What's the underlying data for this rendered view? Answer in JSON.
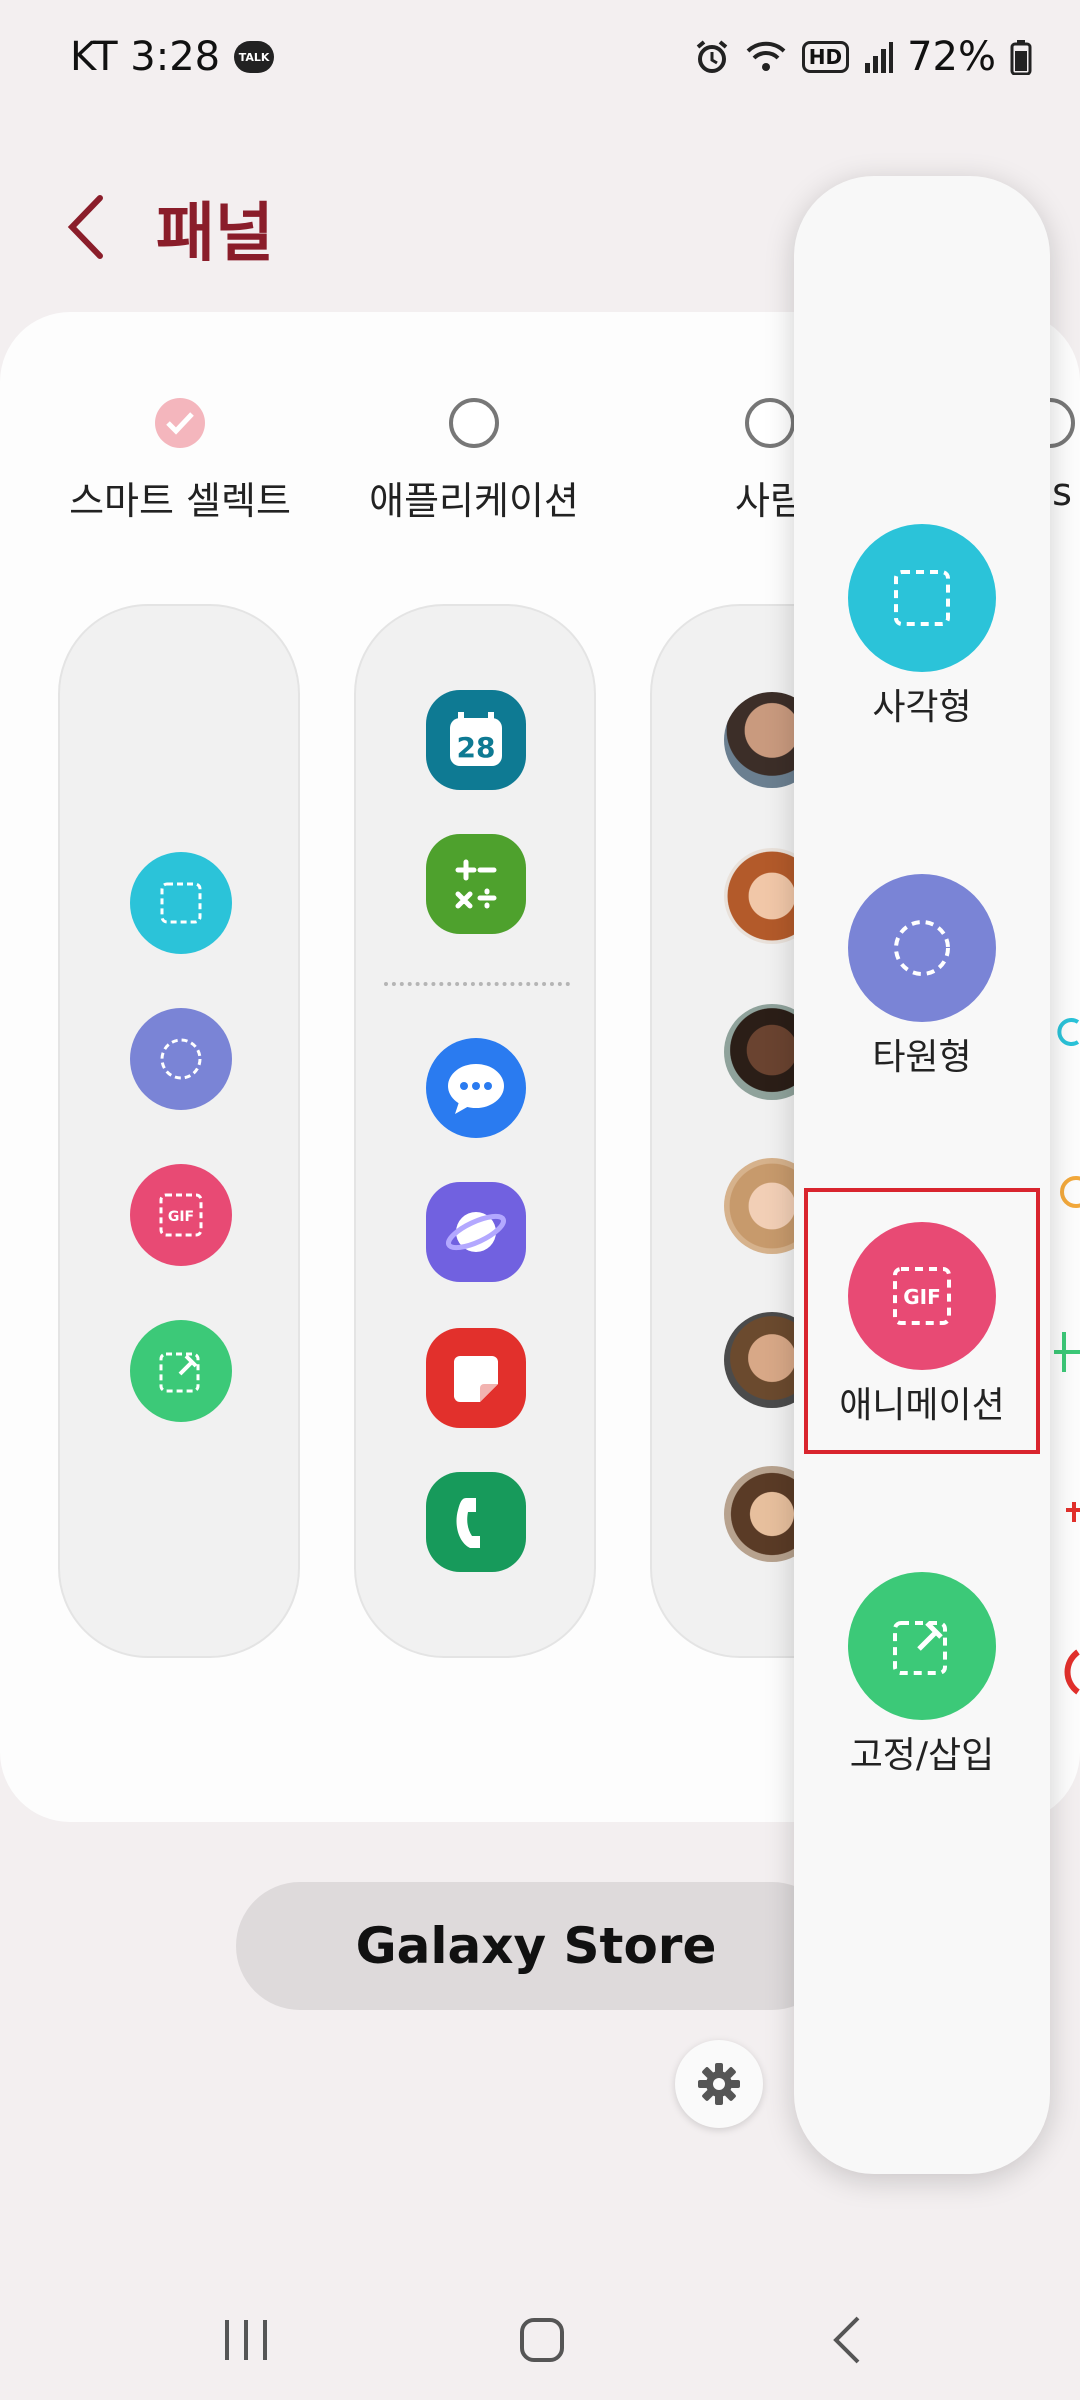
{
  "status_bar": {
    "carrier_time": "KT 3:28",
    "talk_badge": "TALK",
    "hd_badge": "HD",
    "battery": "72%",
    "icons": [
      "talk-icon",
      "alarm-icon",
      "wifi-icon",
      "hd-icon",
      "signal-icon",
      "battery-icon"
    ]
  },
  "header": {
    "title": "패널"
  },
  "options": [
    {
      "label": "스마트 셀렉트",
      "checked": true
    },
    {
      "label": "애플리케이션",
      "checked": false
    },
    {
      "label": "사람",
      "checked": false
    },
    {
      "label": "ns",
      "checked": false
    }
  ],
  "smart_select_column": [
    "rectangle",
    "oval",
    "animation",
    "pin-insert"
  ],
  "apps_column": [
    "calendar",
    "calculator",
    "messages",
    "internet",
    "notes",
    "phone"
  ],
  "calendar_day": "28",
  "gif_text": "GIF",
  "store_button": {
    "label": "Galaxy Store"
  },
  "panel": {
    "items": [
      {
        "label": "사각형",
        "color": "#2bc3d9"
      },
      {
        "label": "타원형",
        "color": "#7a84d6"
      },
      {
        "label": "애니메이션",
        "color": "#e84a74"
      },
      {
        "label": "고정/삽입",
        "color": "#3cc978"
      }
    ]
  },
  "colors": {
    "accent": "#8a1d2a",
    "highlight": "#d9252e"
  }
}
